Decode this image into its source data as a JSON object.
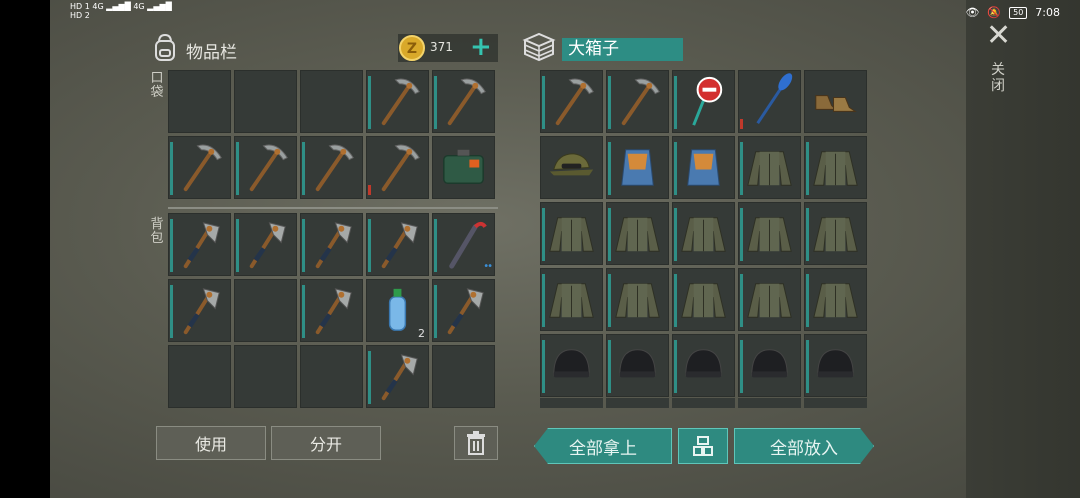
{
  "status_bar": {
    "left_line1": "HD 1  4G ▂▄▆█ 4G ▂▄▆█",
    "left_line2": "HD 2",
    "battery": "50",
    "time": "7:08"
  },
  "inventory": {
    "title": "物品栏",
    "coins": "371",
    "add": "+",
    "pocket_label": "口袋",
    "backpack_label": "背包"
  },
  "chest": {
    "title": "大箱子"
  },
  "buttons": {
    "use": "使用",
    "split": "分开",
    "take_all": "全部拿上",
    "put_all": "全部放入",
    "close": "关闭"
  },
  "pocket": [
    {
      "item": "empty"
    },
    {
      "item": "empty"
    },
    {
      "item": "empty"
    },
    {
      "item": "pickaxe",
      "bar": "full"
    },
    {
      "item": "pickaxe",
      "bar": "full"
    },
    {
      "item": "pickaxe",
      "bar": "full"
    },
    {
      "item": "pickaxe",
      "bar": "full"
    },
    {
      "item": "pickaxe",
      "bar": "full"
    },
    {
      "item": "pickaxe",
      "bar": "low"
    },
    {
      "item": "medkit"
    }
  ],
  "backpack": [
    {
      "item": "axe",
      "bar": "full"
    },
    {
      "item": "axe",
      "bar": "full"
    },
    {
      "item": "axe",
      "bar": "full"
    },
    {
      "item": "axe",
      "bar": "full"
    },
    {
      "item": "crowbar",
      "bar": "full",
      "dots": "••"
    },
    {
      "item": "axe",
      "bar": "full"
    },
    {
      "item": "empty"
    },
    {
      "item": "axe",
      "bar": "full"
    },
    {
      "item": "bottle",
      "count": "2"
    },
    {
      "item": "axe",
      "bar": "full"
    },
    {
      "item": "empty"
    },
    {
      "item": "empty"
    },
    {
      "item": "empty"
    },
    {
      "item": "axe",
      "bar": "full"
    },
    {
      "item": "empty"
    }
  ],
  "chest_items": [
    {
      "item": "pickaxe",
      "bar": "full"
    },
    {
      "item": "pickaxe",
      "bar": "full"
    },
    {
      "item": "sign",
      "bar": "full"
    },
    {
      "item": "paddle",
      "bar": "low"
    },
    {
      "item": "boots"
    },
    {
      "item": "cap"
    },
    {
      "item": "vest",
      "bar": "full"
    },
    {
      "item": "vest",
      "bar": "full"
    },
    {
      "item": "jacket",
      "bar": "full"
    },
    {
      "item": "jacket",
      "bar": "full"
    },
    {
      "item": "jacket",
      "bar": "full"
    },
    {
      "item": "jacket",
      "bar": "full"
    },
    {
      "item": "jacket",
      "bar": "full"
    },
    {
      "item": "jacket",
      "bar": "full"
    },
    {
      "item": "jacket",
      "bar": "full"
    },
    {
      "item": "jacket",
      "bar": "full"
    },
    {
      "item": "jacket",
      "bar": "full"
    },
    {
      "item": "jacket",
      "bar": "full"
    },
    {
      "item": "jacket",
      "bar": "full"
    },
    {
      "item": "jacket",
      "bar": "full"
    },
    {
      "item": "beanie",
      "bar": "full"
    },
    {
      "item": "beanie",
      "bar": "full"
    },
    {
      "item": "beanie",
      "bar": "full"
    },
    {
      "item": "beanie",
      "bar": "full"
    },
    {
      "item": "beanie",
      "bar": "full"
    }
  ]
}
